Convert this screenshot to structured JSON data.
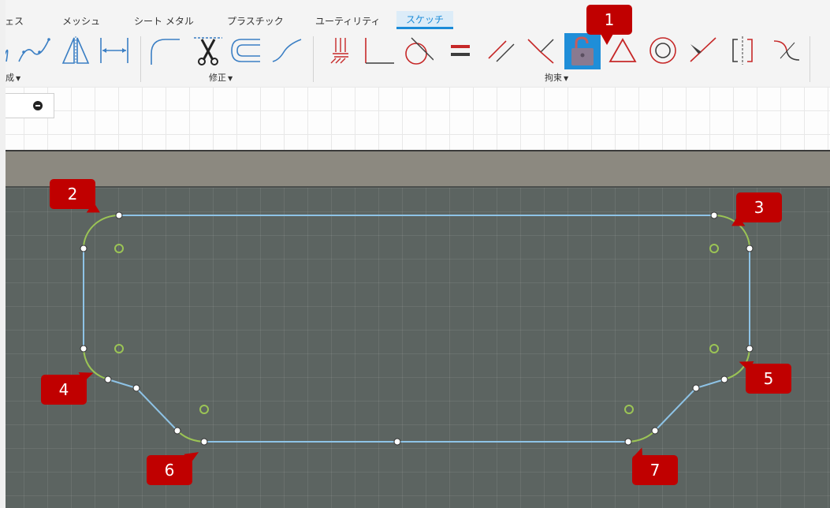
{
  "toolbar": {
    "tabs": [
      {
        "label": "ェス",
        "active": false
      },
      {
        "label": "メッシュ",
        "active": false
      },
      {
        "label": "シート メタル",
        "active": false
      },
      {
        "label": "プラスチック",
        "active": false
      },
      {
        "label": "ユーティリティ",
        "active": false
      },
      {
        "label": "スケッチ",
        "active": true
      }
    ],
    "groups": [
      {
        "label": "作成"
      },
      {
        "label": "修正"
      },
      {
        "label": "拘束"
      }
    ],
    "create_icons": [
      "spline-icon",
      "mirror-icon",
      "dimension-icon"
    ],
    "modify_icons": [
      "fillet-icon",
      "trim-icon",
      "offset-icon",
      "extend-curve-icon"
    ],
    "constraint_icons": [
      "fix-icon",
      "perpendicular-icon",
      "tangent-icon",
      "equal-icon",
      "parallel-icon",
      "coincident-icon",
      "lock-icon",
      "triangle-icon",
      "concentric-icon",
      "midpoint-icon",
      "symmetry-icon",
      "smooth-icon"
    ],
    "accent": "#1a8bd8",
    "constraint_color": "#c62828",
    "lock_highlight": "#1f8ed8"
  },
  "left_panel": {
    "toggle_icon": "minus-circle-icon"
  },
  "canvas": {
    "background": "#5c6461",
    "line_color": "#8ec3e6",
    "fillet_color": "#9bc455",
    "center_color": "#9bc455"
  },
  "callouts": [
    {
      "label": "1"
    },
    {
      "label": "2"
    },
    {
      "label": "3"
    },
    {
      "label": "4"
    },
    {
      "label": "5"
    },
    {
      "label": "6"
    },
    {
      "label": "7"
    }
  ],
  "callout_color": "#c00000"
}
